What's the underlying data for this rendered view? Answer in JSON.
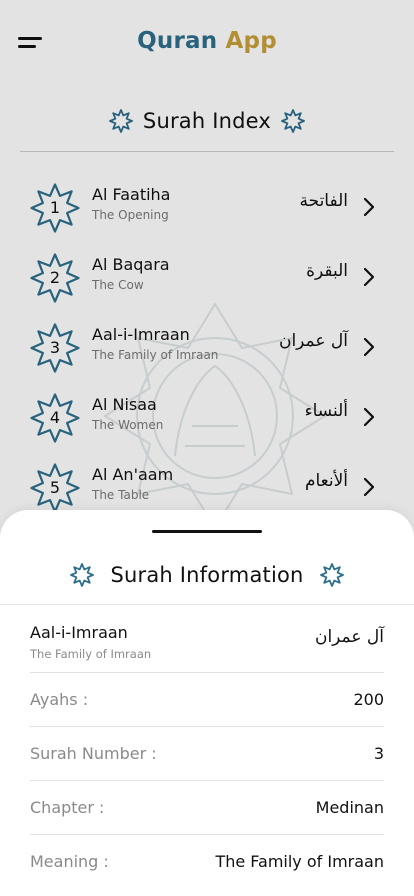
{
  "header": {
    "title_part1": "Quran",
    "title_part2": "App",
    "menu_icon": "hamburger-menu-icon",
    "colors": {
      "title_part1": "#2e6f8c",
      "title_part2": "#c9a13b"
    }
  },
  "index": {
    "title": "Surah Index",
    "decor_icon": "octagram-star-icon",
    "surahs": [
      {
        "number": "1",
        "name": "Al Faatiha",
        "meaning": "The Opening",
        "arabic": "الفاتحة"
      },
      {
        "number": "2",
        "name": "Al Baqara",
        "meaning": "The Cow",
        "arabic": "البقرة"
      },
      {
        "number": "3",
        "name": "Aal-i-Imraan",
        "meaning": "The Family of Imraan",
        "arabic": "آل عمران"
      },
      {
        "number": "4",
        "name": "Al Nisaa",
        "meaning": "The Women",
        "arabic": "ألنساء"
      },
      {
        "number": "5",
        "name": "Al An'aam",
        "meaning": "The Table",
        "arabic": "ألأنعام"
      }
    ]
  },
  "sheet": {
    "title": "Surah Information",
    "surah": {
      "name": "Aal-i-Imraan",
      "meaning": "The Family of Imraan",
      "arabic": "آل عمران"
    },
    "rows": [
      {
        "label": "Ayahs :",
        "value": "200"
      },
      {
        "label": "Surah Number :",
        "value": "3"
      },
      {
        "label": "Chapter :",
        "value": "Medinan"
      },
      {
        "label": "Meaning :",
        "value": "The Family of Imraan"
      }
    ]
  },
  "colors": {
    "accent": "#2e6f8c",
    "gold": "#c9a13b",
    "muted": "#8a8a8a"
  }
}
